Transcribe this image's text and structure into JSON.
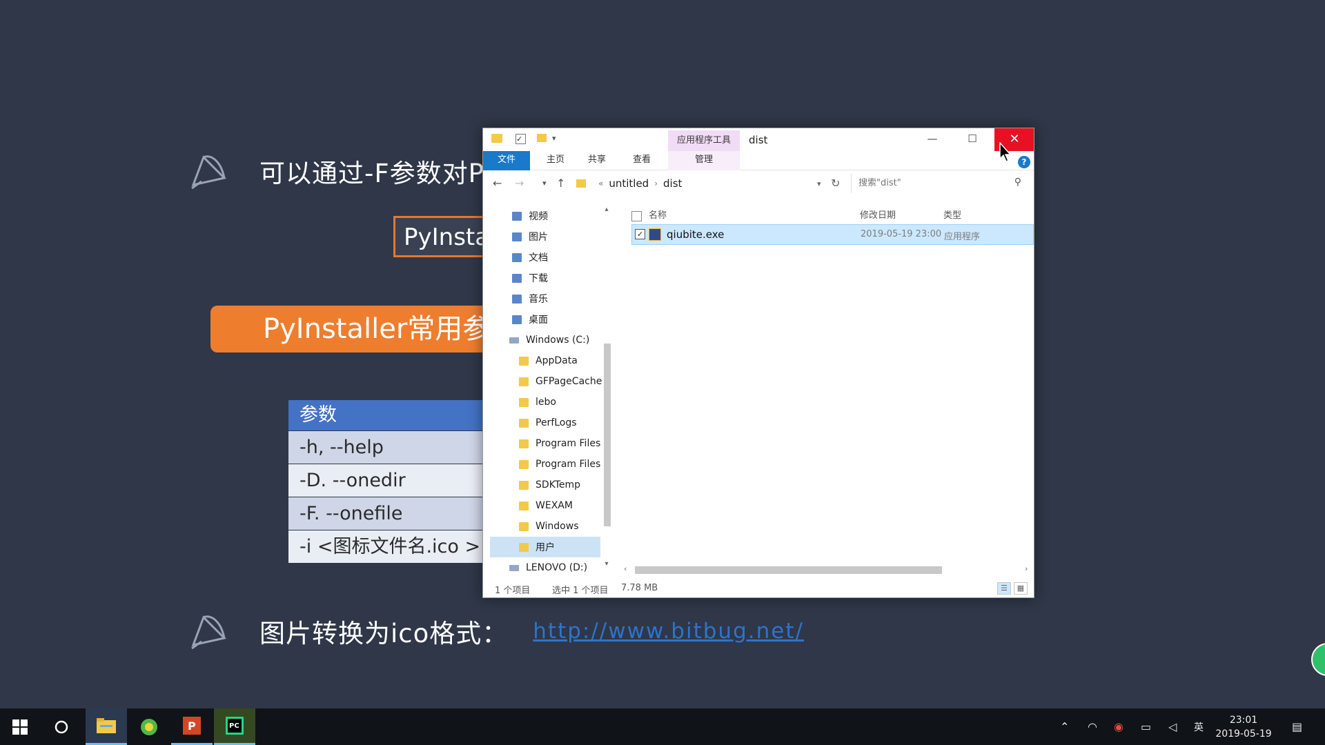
{
  "slide": {
    "bullet1_text": "可以通过-F参数对Py",
    "cmd_text": "PyInsta",
    "orange_title": "PyInstaller常用参",
    "param_table": {
      "header": "参数",
      "rows": [
        "-h, --help",
        "-D. --onedir",
        "-F. --onefile",
        "-i <图标文件名.ico >"
      ]
    },
    "bullet2_text": "图片转换为ico格式：",
    "bullet2_link": "http://www.bitbug.net/"
  },
  "explorer": {
    "context_tab": "应用程序工具",
    "window_title": "dist",
    "ribbon_tabs": {
      "file": "文件",
      "home": "主页",
      "share": "共享",
      "view": "查看",
      "manage": "管理"
    },
    "help_icon": "?",
    "breadcrumb": [
      "untitled",
      "dist"
    ],
    "search_placeholder": "搜索\"dist\"",
    "nav_items": [
      {
        "label": "视频",
        "icon": "video-library-icon"
      },
      {
        "label": "图片",
        "icon": "pictures-library-icon"
      },
      {
        "label": "文档",
        "icon": "documents-library-icon"
      },
      {
        "label": "下载",
        "icon": "downloads-icon"
      },
      {
        "label": "音乐",
        "icon": "music-library-icon"
      },
      {
        "label": "桌面",
        "icon": "desktop-icon"
      },
      {
        "label": "Windows (C:)",
        "icon": "drive-icon"
      },
      {
        "label": "AppData",
        "icon": "folder-icon"
      },
      {
        "label": "GFPageCache",
        "icon": "folder-icon"
      },
      {
        "label": "lebo",
        "icon": "folder-icon"
      },
      {
        "label": "PerfLogs",
        "icon": "folder-icon"
      },
      {
        "label": "Program Files",
        "icon": "folder-icon"
      },
      {
        "label": "Program Files",
        "icon": "folder-icon"
      },
      {
        "label": "SDKTemp",
        "icon": "folder-icon"
      },
      {
        "label": "WEXAM",
        "icon": "folder-icon"
      },
      {
        "label": "Windows",
        "icon": "folder-icon"
      },
      {
        "label": "用户",
        "icon": "folder-icon"
      },
      {
        "label": "LENOVO (D:)",
        "icon": "drive-icon"
      }
    ],
    "columns": {
      "name": "名称",
      "date": "修改日期",
      "type": "类型"
    },
    "files": [
      {
        "name": "qiubite.exe",
        "date": "2019-05-19 23:00",
        "type": "应用程序"
      }
    ],
    "status": {
      "count": "1 个项目",
      "selected": "选中 1 个项目",
      "size": "7.78 MB"
    }
  },
  "taskbar": {
    "apps": [
      "start-icon",
      "cortana-icon",
      "file-explorer-icon",
      "360-browser-icon",
      "powerpoint-icon",
      "pycharm-icon"
    ],
    "tray_ime": "英",
    "clock_time": "23:01",
    "clock_date": "2019-05-19"
  }
}
